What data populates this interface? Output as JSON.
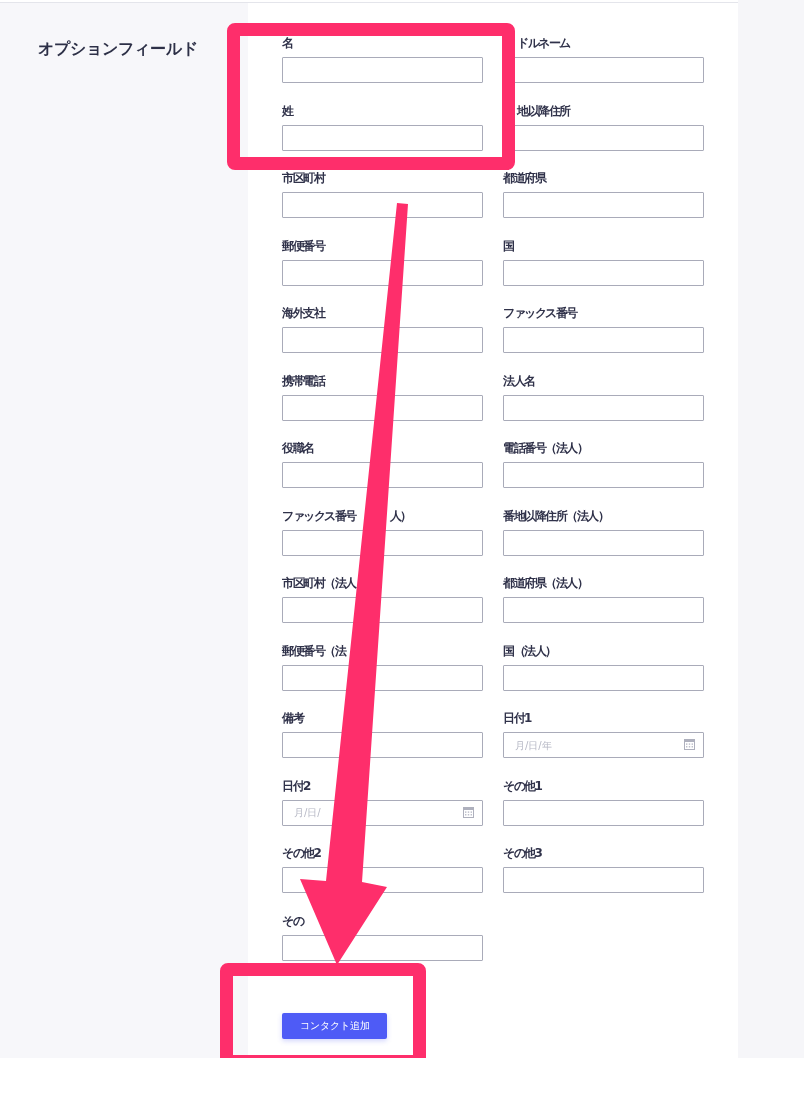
{
  "section": {
    "title": "オプションフィールド"
  },
  "fields": [
    {
      "kind": "text",
      "label": "名"
    },
    {
      "kind": "text",
      "label": "ドルネーム",
      "lead_hidden": true
    },
    {
      "kind": "text",
      "label": "姓"
    },
    {
      "kind": "text",
      "label": "地以降住所",
      "lead_hidden": true
    },
    {
      "kind": "text",
      "label": "市区町村"
    },
    {
      "kind": "text",
      "label": "都道府県"
    },
    {
      "kind": "text",
      "label": "郵便番号"
    },
    {
      "kind": "text",
      "label": "国"
    },
    {
      "kind": "text",
      "label": "海外支社"
    },
    {
      "kind": "text",
      "label": "ファックス番号"
    },
    {
      "kind": "text",
      "label": "携帯電話"
    },
    {
      "kind": "text",
      "label": "法人名"
    },
    {
      "kind": "text",
      "label": "役職名"
    },
    {
      "kind": "text",
      "label": "電話番号（法人）"
    },
    {
      "kind": "text",
      "label": "ファックス番号",
      "label_tail": "人）"
    },
    {
      "kind": "text",
      "label": "番地以降住所（法人）"
    },
    {
      "kind": "text",
      "label": "市区町村（法人"
    },
    {
      "kind": "text",
      "label": "都道府県（法人）"
    },
    {
      "kind": "text",
      "label": "郵便番号（法"
    },
    {
      "kind": "text",
      "label": "国（法人）"
    },
    {
      "kind": "text",
      "label": "備考"
    },
    {
      "kind": "date",
      "label": "日付1",
      "placeholder": "月/日/年"
    },
    {
      "kind": "date",
      "label": "日付2",
      "placeholder": "月/日/"
    },
    {
      "kind": "text",
      "label": "その他1"
    },
    {
      "kind": "text",
      "label": "その他2"
    },
    {
      "kind": "text",
      "label": "その他3"
    },
    {
      "kind": "text",
      "label": "その"
    }
  ],
  "submit_button": {
    "label": "コンタクト追加"
  }
}
